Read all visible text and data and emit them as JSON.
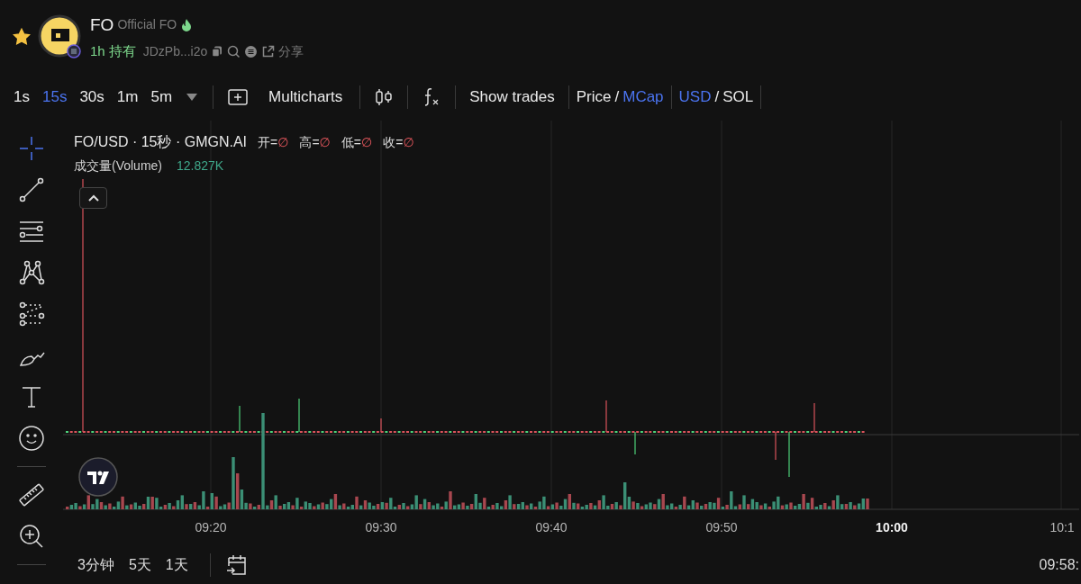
{
  "header": {
    "starred": true,
    "symbol": "FO",
    "name": "Official FO",
    "age": "1h",
    "holders_label": "持有",
    "address": "JDzPb...i2o",
    "share": "分享"
  },
  "toolbar": {
    "intervals": [
      {
        "label": "1s",
        "selected": false
      },
      {
        "label": "15s",
        "selected": true
      },
      {
        "label": "30s",
        "selected": false
      },
      {
        "label": "1m",
        "selected": false
      },
      {
        "label": "5m",
        "selected": false
      }
    ],
    "multicharts": "Multicharts",
    "show_trades": "Show trades",
    "toggles": [
      {
        "options": [
          {
            "label": "Price",
            "selected": false
          },
          {
            "label": "MCap",
            "selected": true
          }
        ]
      },
      {
        "options": [
          {
            "label": "USD",
            "selected": true
          },
          {
            "label": "SOL",
            "selected": false
          }
        ]
      }
    ],
    "separator": "/"
  },
  "tools": [
    {
      "kind": "crosshair",
      "selected": true
    },
    {
      "kind": "trendline",
      "selected": false
    },
    {
      "kind": "lines",
      "selected": false
    },
    {
      "kind": "pattern",
      "selected": false
    },
    {
      "kind": "fib",
      "selected": false
    },
    {
      "kind": "brush",
      "selected": false
    },
    {
      "kind": "text",
      "selected": false
    },
    {
      "kind": "emoji",
      "selected": false
    },
    {
      "kind": "ruler",
      "selected": false
    },
    {
      "kind": "zoom",
      "selected": false
    }
  ],
  "legend": {
    "title": "FO/USD · 15秒 · GMGN.AI",
    "ohlc": [
      {
        "label": "开=",
        "value": "∅"
      },
      {
        "label": "高=",
        "value": "∅"
      },
      {
        "label": "低=",
        "value": "∅"
      },
      {
        "label": "收=",
        "value": "∅"
      }
    ],
    "volume_label": "成交量(Volume)",
    "volume_value": "12.827K"
  },
  "x_axis": [
    {
      "label": "09:20",
      "emphasized": false
    },
    {
      "label": "09:30",
      "emphasized": false
    },
    {
      "label": "09:40",
      "emphasized": false
    },
    {
      "label": "09:50",
      "emphasized": false
    },
    {
      "label": "10:00",
      "emphasized": true
    },
    {
      "label": "10:1",
      "emphasized": false
    }
  ],
  "bottom": {
    "ranges": [
      "3分钟",
      "5天",
      "1天"
    ],
    "time": "09:58:"
  }
}
